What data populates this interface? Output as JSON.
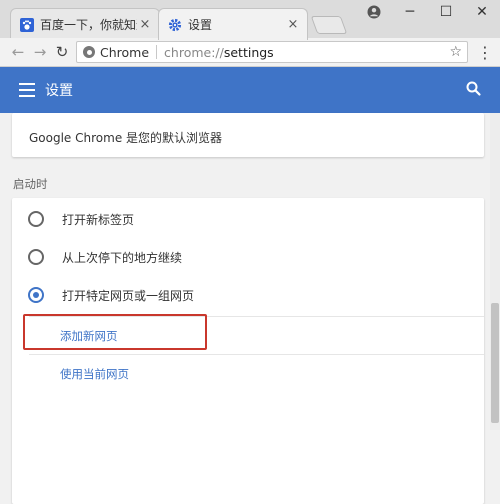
{
  "tabs": [
    {
      "label": "百度一下，你就知道",
      "icon": "baidu-paw-icon",
      "active": false
    },
    {
      "label": "设置",
      "icon": "gear-icon",
      "active": true
    }
  ],
  "window_controls": {
    "profile": "profile-icon",
    "minimize": "─",
    "maximize": "☐",
    "close": "✕"
  },
  "address_bar": {
    "site_name": "Chrome",
    "url_scheme": "chrome://",
    "url_path": "settings",
    "bookmark_icon": "star-icon"
  },
  "glyphs": {
    "close": "×",
    "back": "←",
    "forward": "→",
    "reload": "↻",
    "star": "☆",
    "menu": "⋮"
  },
  "header": {
    "title": "设置"
  },
  "default_browser": {
    "text": "Google Chrome 是您的默认浏览器"
  },
  "startup": {
    "heading": "启动时",
    "options": [
      {
        "label": "打开新标签页",
        "checked": false
      },
      {
        "label": "从上次停下的地方继续",
        "checked": false
      },
      {
        "label": "打开特定网页或一组网页",
        "checked": true
      }
    ],
    "add_page": "添加新网页",
    "use_current": "使用当前网页"
  },
  "colors": {
    "accent": "#3f74c7",
    "highlight_border": "#c9372c"
  }
}
